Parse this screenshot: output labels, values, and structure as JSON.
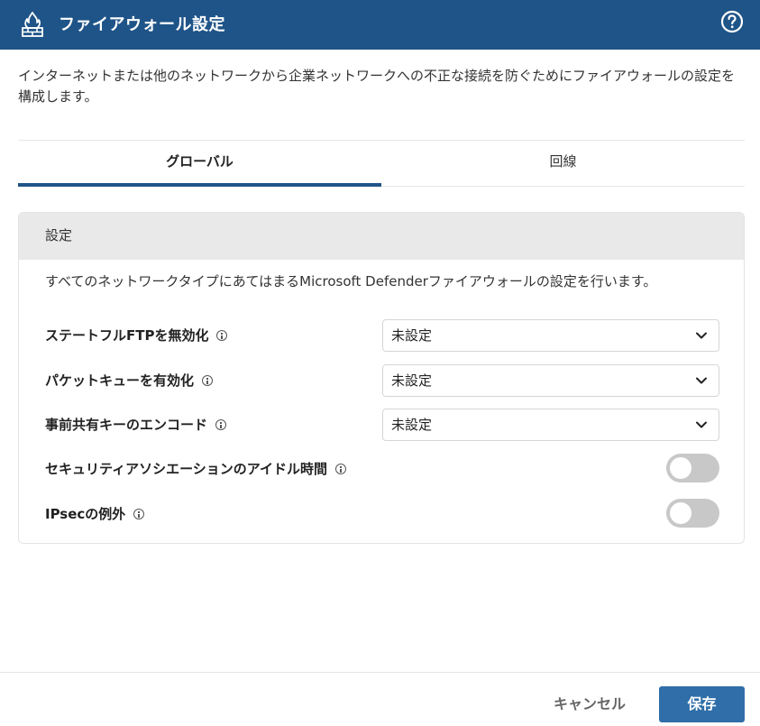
{
  "header": {
    "title": "ファイアウォール設定",
    "icon": "firewall-icon",
    "help_icon": "help-icon",
    "bg_color": "#1f5488"
  },
  "description": "インターネットまたは他のネットワークから企業ネットワークへの不正な接続を防ぐためにファイアウォールの設定を構成します。",
  "tabs": [
    {
      "label": "グローバル",
      "active": true
    },
    {
      "label": "回線",
      "active": false
    }
  ],
  "card": {
    "title": "設定",
    "description": "すべてのネットワークタイプにあてはまるMicrosoft Defenderファイアウォールの設定を行います。",
    "rows": [
      {
        "label": "ステートフルFTPを無効化",
        "type": "select",
        "value": "未設定"
      },
      {
        "label": "パケットキューを有効化",
        "type": "select",
        "value": "未設定"
      },
      {
        "label": "事前共有キーのエンコード",
        "type": "select",
        "value": "未設定"
      },
      {
        "label": "セキュリティアソシエーションのアイドル時間",
        "type": "toggle",
        "on": false
      },
      {
        "label": "IPsecの例外",
        "type": "toggle",
        "on": false
      }
    ]
  },
  "footer": {
    "cancel_label": "キャンセル",
    "save_label": "保存",
    "accent_color": "#2f6ea8"
  }
}
